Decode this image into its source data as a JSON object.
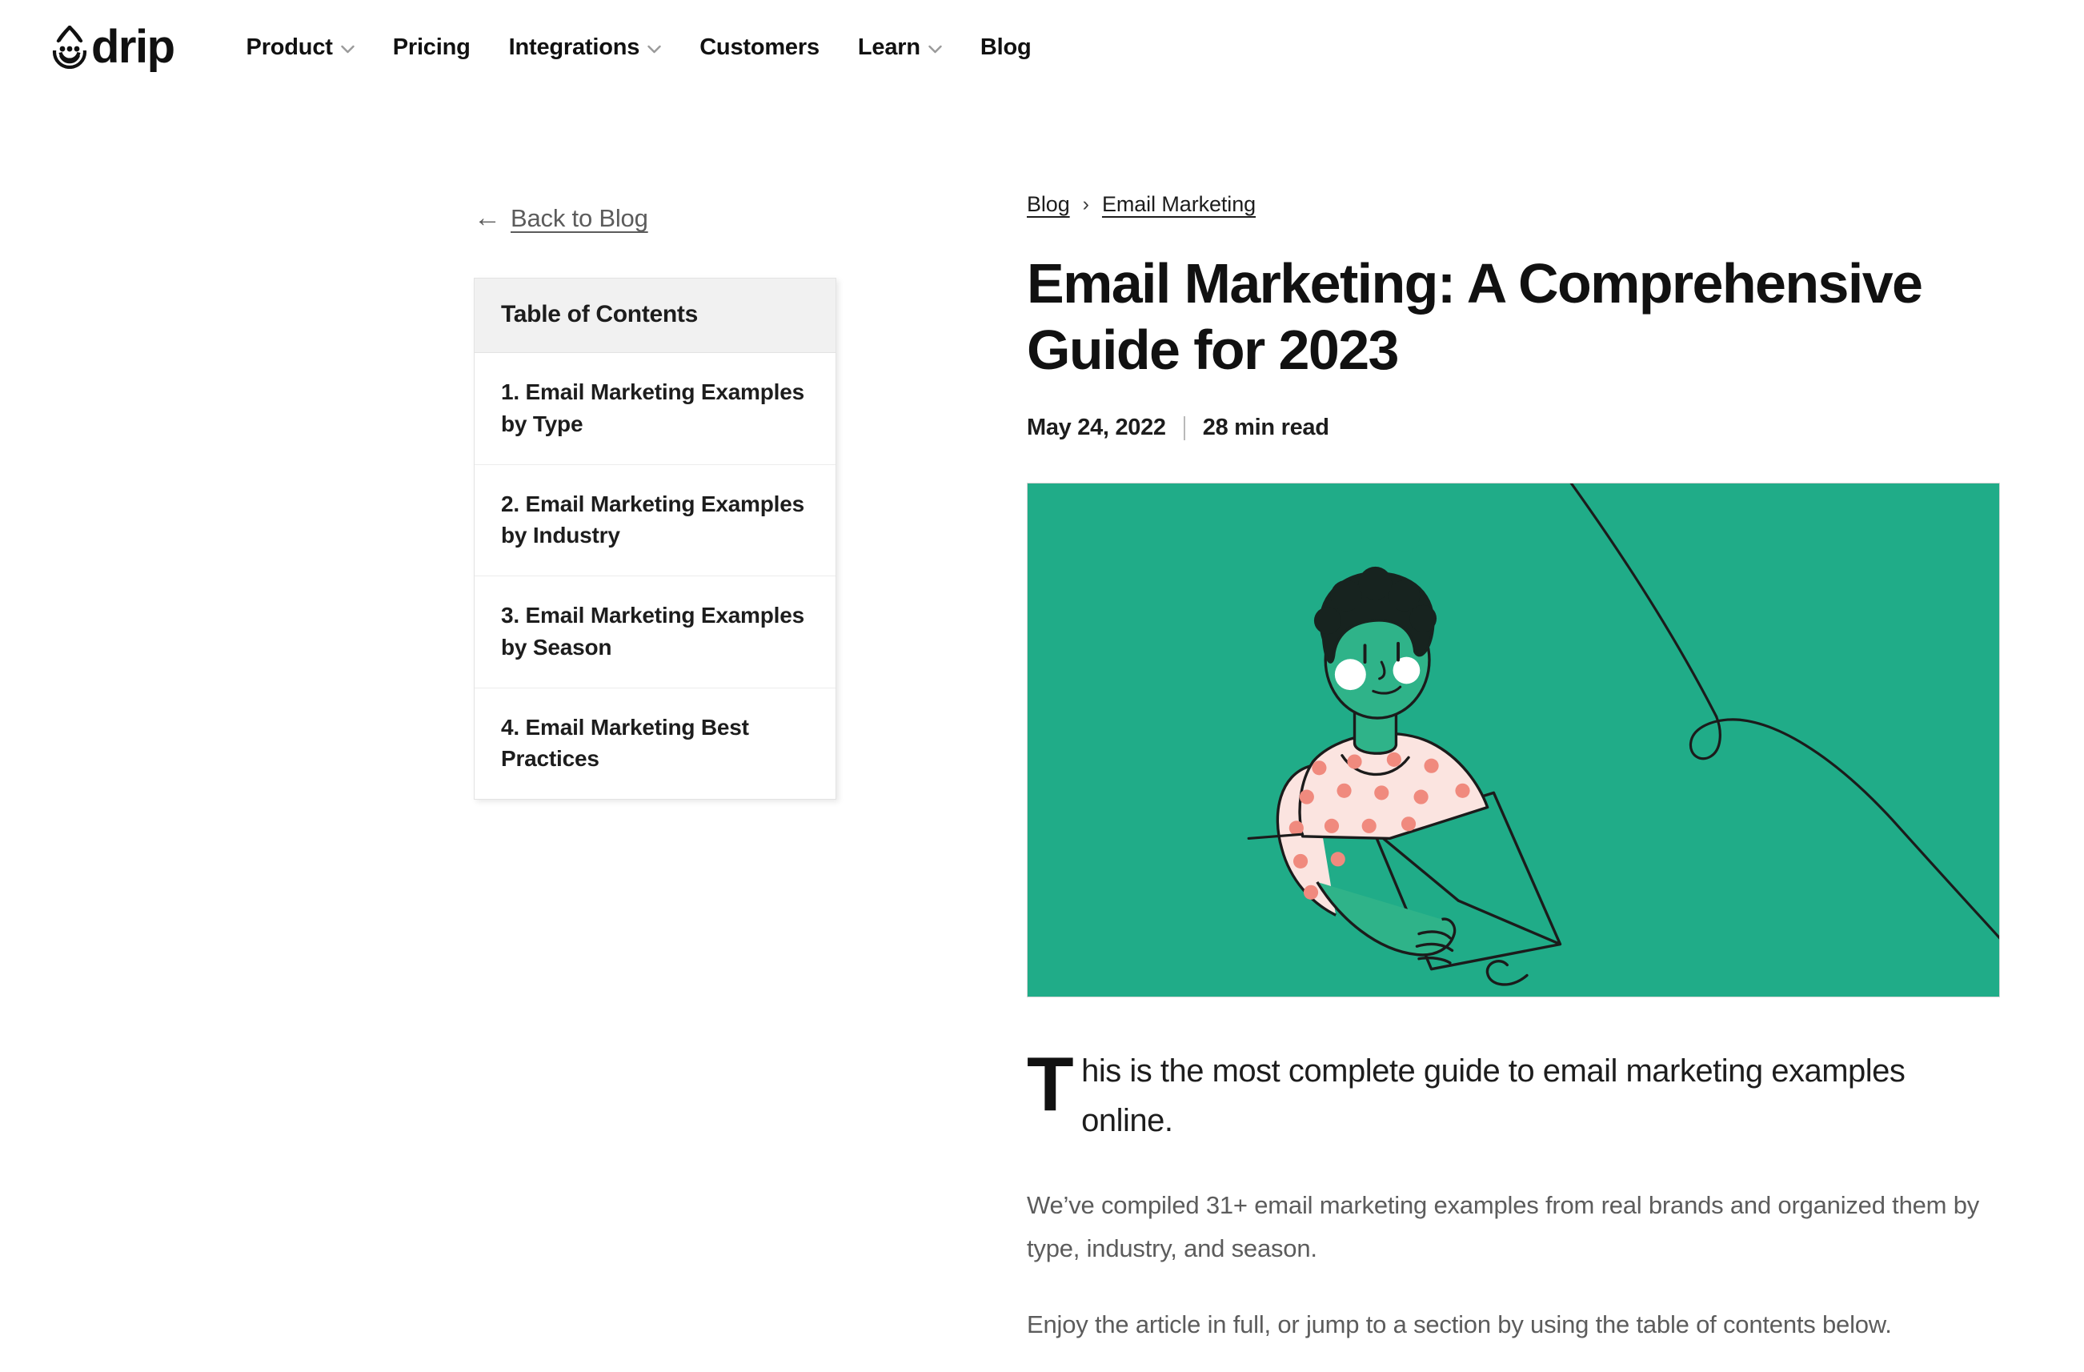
{
  "brand": {
    "name": "drip",
    "logo_icon": "drip-droplet-face-icon",
    "color": "#111111"
  },
  "nav": {
    "items": [
      {
        "label": "Product",
        "has_dropdown": true,
        "icon": "chevron-down-icon"
      },
      {
        "label": "Pricing",
        "has_dropdown": false
      },
      {
        "label": "Integrations",
        "has_dropdown": true,
        "icon": "chevron-down-icon"
      },
      {
        "label": "Customers",
        "has_dropdown": false
      },
      {
        "label": "Learn",
        "has_dropdown": true,
        "icon": "chevron-down-icon"
      },
      {
        "label": "Blog",
        "has_dropdown": false
      }
    ]
  },
  "sidebar": {
    "back_link": {
      "label": "Back to Blog",
      "icon": "arrow-left-icon",
      "arrow_glyph": "←"
    },
    "toc": {
      "title": "Table of Contents",
      "items": [
        {
          "label": "1. Email Marketing Examples by Type"
        },
        {
          "label": "2. Email Marketing Examples by Industry"
        },
        {
          "label": "3. Email Marketing Examples by Season"
        },
        {
          "label": "4. Email Marketing Best Practices"
        }
      ]
    }
  },
  "article": {
    "breadcrumb": {
      "items": [
        {
          "label": "Blog"
        },
        {
          "label": "Email Marketing"
        }
      ],
      "separator": "›",
      "separator_icon": "chevron-right-icon"
    },
    "title": "Email Marketing: A Comprehensive Guide for 2023",
    "meta": {
      "date": "May 24, 2022",
      "read_time": "28 min read",
      "divider": "|"
    },
    "hero": {
      "alt": "Illustration of a person holding a large envelope",
      "background_color": "#20ac88",
      "line_color": "#1b1b1b",
      "skin_color": "#2fb389",
      "hair_color": "#17231f",
      "shirt_color": "#fbe4e0",
      "dot_color": "#f08a7e",
      "highlight_color": "#ffffff"
    },
    "lede": {
      "dropcap": "T",
      "rest": "his is the most complete guide to email marketing examples online."
    },
    "paragraphs": [
      "We’ve compiled 31+ email marketing examples from real brands and organized them by type, industry, and season.",
      "Enjoy the article in full, or jump to a section by using the table of contents below."
    ]
  }
}
